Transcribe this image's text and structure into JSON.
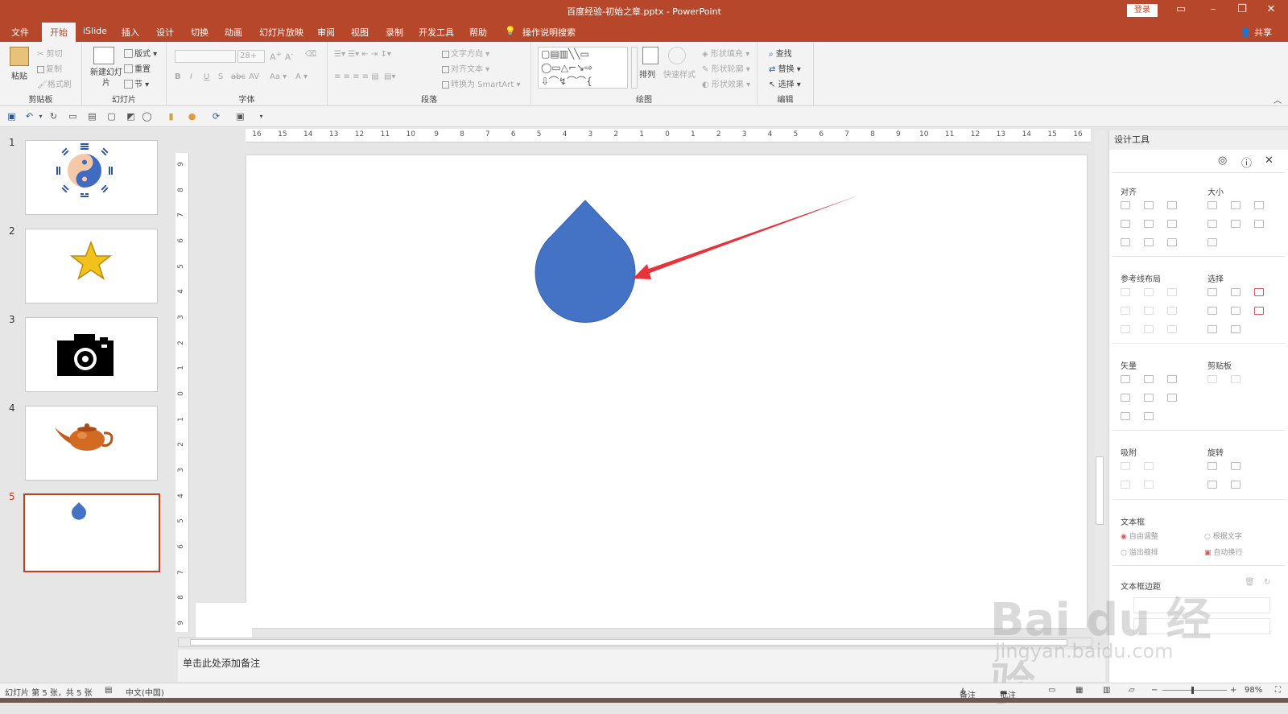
{
  "window": {
    "title": "百度经验-初始之章.pptx  -  PowerPoint",
    "login": "登录"
  },
  "tabs": [
    "文件",
    "开始",
    "iSlide",
    "插入",
    "设计",
    "切换",
    "动画",
    "幻灯片放映",
    "审阅",
    "视图",
    "录制",
    "开发工具",
    "帮助"
  ],
  "active_tab": "开始",
  "tell_me": "操作说明搜索",
  "share": "共享",
  "ribbon": {
    "clipboard": {
      "label": "剪贴板",
      "paste": "粘贴",
      "cut": "剪切",
      "copy": "复制",
      "format_painter": "格式刷"
    },
    "slides": {
      "label": "幻灯片",
      "new_slide": "新建幻灯片",
      "layout": "版式",
      "reset": "重置",
      "section": "节"
    },
    "font": {
      "label": "字体",
      "size": "28+"
    },
    "paragraph": {
      "label": "段落",
      "text_direction": "文字方向",
      "align_text": "对齐文本",
      "smartart": "转换为 SmartArt"
    },
    "drawing": {
      "label": "绘图",
      "arrange": "排列",
      "quick_styles": "快速样式",
      "shape_fill": "形状填充",
      "shape_outline": "形状轮廓",
      "shape_effects": "形状效果"
    },
    "editing": {
      "label": "编辑",
      "find": "查找",
      "replace": "替换",
      "select": "选择"
    }
  },
  "slides": [
    {
      "number": "1",
      "content": "yin-yang-bagua"
    },
    {
      "number": "2",
      "content": "star"
    },
    {
      "number": "3",
      "content": "camera"
    },
    {
      "number": "4",
      "content": "teapot"
    },
    {
      "number": "5",
      "content": "water-drop",
      "active": true
    }
  ],
  "ruler_h_labels": [
    "16",
    "15",
    "14",
    "13",
    "12",
    "11",
    "10",
    "9",
    "8",
    "7",
    "6",
    "5",
    "4",
    "3",
    "2",
    "1",
    "0",
    "1",
    "2",
    "3",
    "4",
    "5",
    "6",
    "7",
    "8",
    "9",
    "10",
    "11",
    "12",
    "13",
    "14",
    "15",
    "16"
  ],
  "ruler_v_labels": [
    "9",
    "8",
    "7",
    "6",
    "5",
    "4",
    "3",
    "2",
    "1",
    "0",
    "1",
    "2",
    "3",
    "4",
    "5",
    "6",
    "7",
    "8",
    "9"
  ],
  "notes_placeholder": "单击此处添加备注",
  "design_pane": {
    "title": "设计工具",
    "sections": {
      "align": "对齐",
      "size": "大小",
      "guides": "参考线布局",
      "select": "选择",
      "vector": "矢量",
      "clipboard": "剪贴板",
      "snap": "吸附",
      "rotate": "旋转",
      "textbox": "文本框",
      "textbox_margin": "文本框边距"
    },
    "textbox_options": {
      "auto_adjust": "自由调整",
      "fit_text": "根据文字",
      "overflow_shrink": "溢出缩排",
      "auto_wrap": "自动换行"
    }
  },
  "status": {
    "slide_info": "幻灯片 第 5 张，共 5 张",
    "language": "中文(中国)",
    "notes": "备注",
    "comments": "批注",
    "zoom": "98%"
  },
  "colors": {
    "accent": "#b7472a",
    "drop": "#4472c4",
    "arrow": "#e8333b"
  },
  "watermark": {
    "brand": "Bai du 经验",
    "url": "jingyan.baidu.com"
  }
}
